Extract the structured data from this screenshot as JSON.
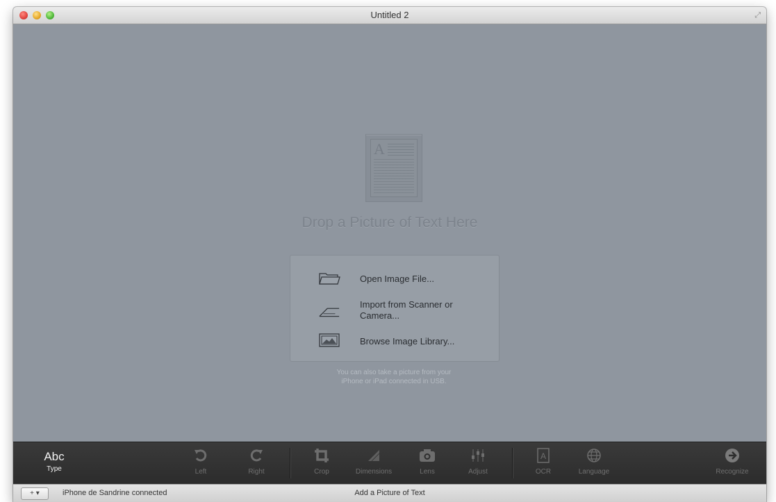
{
  "window": {
    "title": "Untitled 2"
  },
  "dropzone": {
    "title": "Drop a Picture of Text Here",
    "actions": [
      {
        "label": "Open Image File...",
        "icon": "folder-icon"
      },
      {
        "label": "Import from Scanner or Camera...",
        "icon": "scanner-icon"
      },
      {
        "label": "Browse Image Library...",
        "icon": "photo-library-icon"
      }
    ],
    "hint_line1": "You can also take a picture from your",
    "hint_line2": "iPhone or iPad connected in USB."
  },
  "toolbar": {
    "type": {
      "big": "Abc",
      "label": "Type"
    },
    "left": "Left",
    "right": "Right",
    "crop": "Crop",
    "dimensions": "Dimensions",
    "lens": "Lens",
    "adjust": "Adjust",
    "ocr": "OCR",
    "language": "Language",
    "recognize": "Recognize"
  },
  "statusbar": {
    "button": "+ ▾",
    "left": "iPhone de Sandrine connected",
    "center": "Add a Picture of Text"
  }
}
